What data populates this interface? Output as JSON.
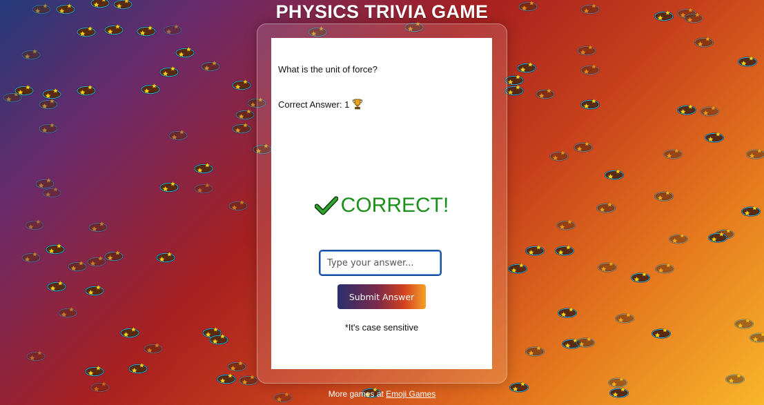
{
  "app": {
    "title": "PHYSICS TRIVIA GAME"
  },
  "game": {
    "question": "What is the unit of force?",
    "correct_answer_label": "Correct Answer: 1",
    "result_text": "CORRECT!",
    "input_placeholder": "Type your answer...",
    "input_value": "",
    "submit_label": "Submit Answer",
    "note": "*It's case sensitive"
  },
  "footer": {
    "prefix": "More games at ",
    "link_text": "Emoji Games"
  },
  "icons": {
    "result_icon": "check-mark-icon",
    "score_icon": "trophy-icon",
    "background_icon": "dizzy-star-icon"
  },
  "colors": {
    "correct": "#1a8f1a",
    "input_border": "#1a4fa0"
  }
}
